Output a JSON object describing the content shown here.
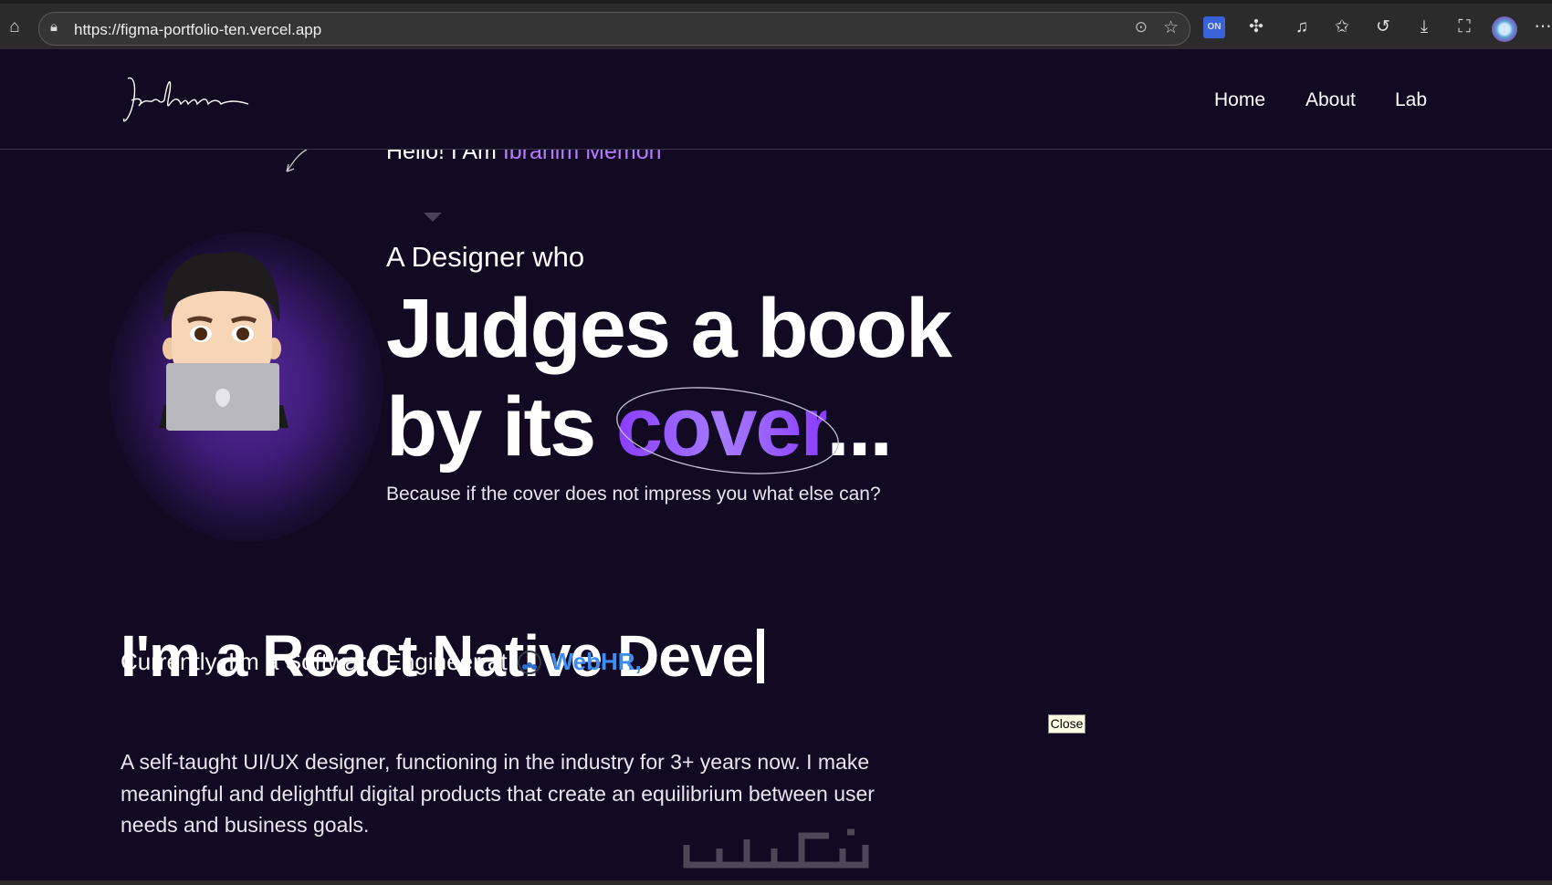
{
  "browser": {
    "url": "https://figma-portfolio-ten.vercel.app",
    "icons": [
      "home-icon",
      "lock-icon",
      "more-icon",
      "favorite-star-icon",
      "extension-on-icon",
      "extensions-icon",
      "media-icon",
      "favorites-icon",
      "history-icon",
      "downloads-icon",
      "screenshot-icon",
      "profile-avatar",
      "menu-icon"
    ]
  },
  "header": {
    "logo_text": "Ibrahim",
    "nav": [
      {
        "label": "Home"
      },
      {
        "label": "About"
      },
      {
        "label": "Lab"
      }
    ]
  },
  "hero": {
    "hello_prefix": "Hello! I Am ",
    "hello_name": "Ibrahim Memon",
    "tagline_small": "A Designer who",
    "line1": "Judges a book",
    "line2_prefix": "by its ",
    "line2_highlight": "cover",
    "line2_suffix": "...",
    "subtitle": "Because if the cover does not impress you what else can?"
  },
  "intro": {
    "role_typed": "I'm a React Native Deve",
    "current_prefix": "Currently, I'm a Software Engineer at",
    "company": "WebHR,",
    "paragraph": "A self-taught UI/UX designer, functioning in the industry for 3+ years now. I make meaningful and delightful digital products that create an equilibrium between user needs and business goals."
  },
  "tooltip": {
    "close_label": "Close"
  },
  "colors": {
    "background": "#110a22",
    "accent_purple": "#8a3cff",
    "name_purple": "#b57cff",
    "company_blue": "#3d8ef0"
  }
}
